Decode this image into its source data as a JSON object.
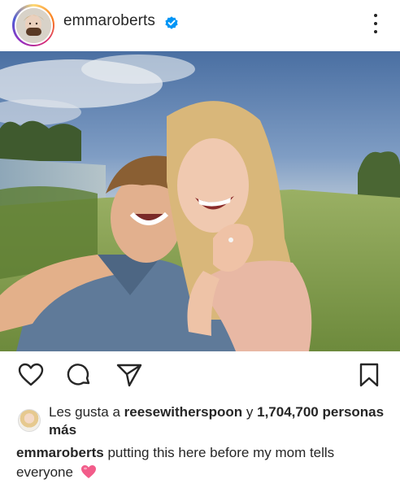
{
  "post": {
    "username": "emmaroberts",
    "verified": true
  },
  "icons": {
    "like": "heart-outline-icon",
    "comment": "comment-bubble-icon",
    "share": "paper-plane-icon",
    "save": "bookmark-icon",
    "more": "more-vertical-icon",
    "verified": "verified-badge-icon",
    "caption_emoji": "pink-heart-emoji"
  },
  "likes": {
    "prefix": "Les gusta a",
    "liker": "reesewitherspoon",
    "joiner": "y",
    "count": "1,704,700",
    "suffix": "personas más"
  },
  "caption": {
    "username": "emmaroberts",
    "text": "putting this here before my mom tells everyone"
  },
  "colors": {
    "verified_blue": "#0095f6",
    "caption_heart": "#f25c8a",
    "text": "#262626"
  }
}
